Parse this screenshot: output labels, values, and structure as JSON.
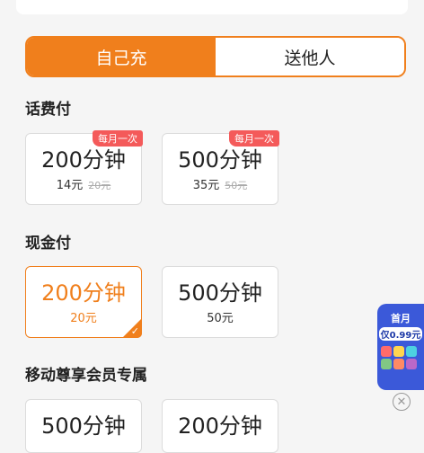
{
  "tabs": {
    "self": "自己充",
    "others": "送他人"
  },
  "sections": {
    "phone_bill": "话费付",
    "cash": "现金付",
    "member": "移动尊享会员专属"
  },
  "phone_bill_cards": [
    {
      "minutes": "200分钟",
      "price": "14元",
      "original": "20元",
      "badge": "每月一次"
    },
    {
      "minutes": "500分钟",
      "price": "35元",
      "original": "50元",
      "badge": "每月一次"
    }
  ],
  "cash_cards": [
    {
      "minutes": "200分钟",
      "price": "20元",
      "selected": true
    },
    {
      "minutes": "500分钟",
      "price": "50元",
      "selected": false
    }
  ],
  "member_cards": [
    {
      "minutes": "500分钟"
    },
    {
      "minutes": "200分钟"
    }
  ],
  "promo": {
    "head": "首月",
    "price": "仅0.99元",
    "close_icon": "close-circle-icon"
  },
  "colors": {
    "accent": "#f07f1c",
    "badge": "#f45a5a",
    "promo_bg": "#3b59d9"
  }
}
